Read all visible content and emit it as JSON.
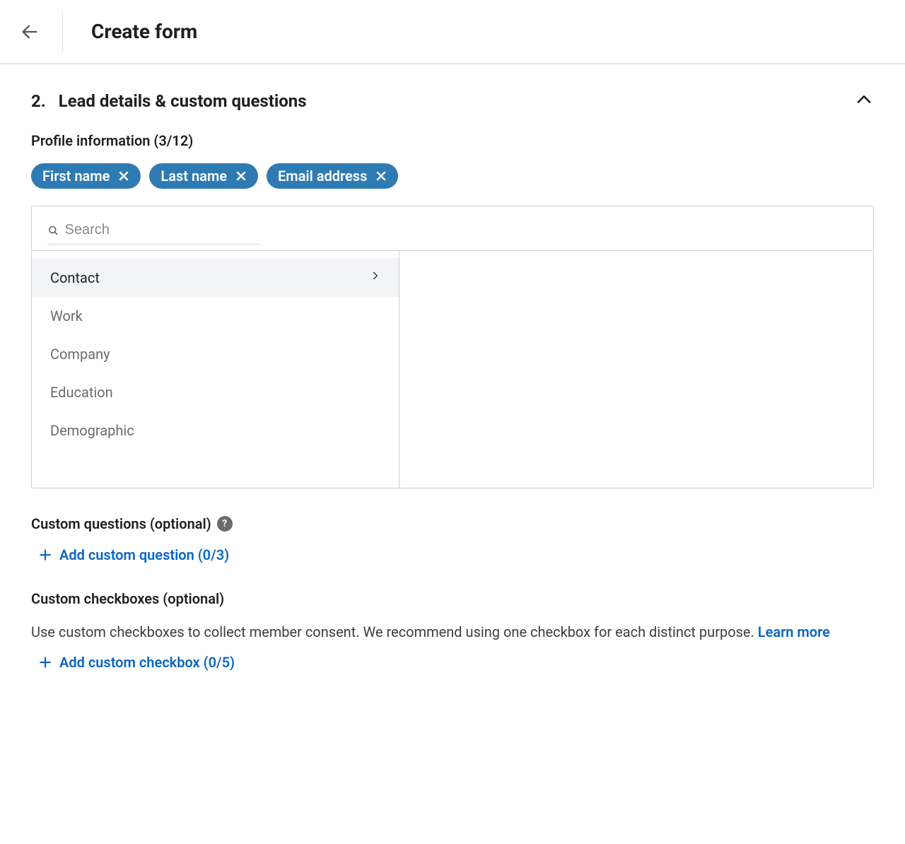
{
  "header": {
    "title": "Create form"
  },
  "section": {
    "number": "2.",
    "title": "Lead details & custom questions"
  },
  "profile_info": {
    "heading": "Profile information (3/12)",
    "chips": [
      {
        "label": "First name"
      },
      {
        "label": "Last name"
      },
      {
        "label": "Email address"
      }
    ]
  },
  "search": {
    "placeholder": "Search"
  },
  "categories": [
    {
      "label": "Contact",
      "active": true
    },
    {
      "label": "Work",
      "active": false
    },
    {
      "label": "Company",
      "active": false
    },
    {
      "label": "Education",
      "active": false
    },
    {
      "label": "Demographic",
      "active": false
    }
  ],
  "custom_questions": {
    "heading": "Custom questions (optional)",
    "add_label": "Add custom question (0/3)"
  },
  "custom_checkboxes": {
    "heading": "Custom checkboxes (optional)",
    "description": "Use custom checkboxes to collect member consent. We recommend using one checkbox for each distinct purpose. ",
    "learn_more": "Learn more",
    "add_label": "Add custom checkbox (0/5)"
  }
}
